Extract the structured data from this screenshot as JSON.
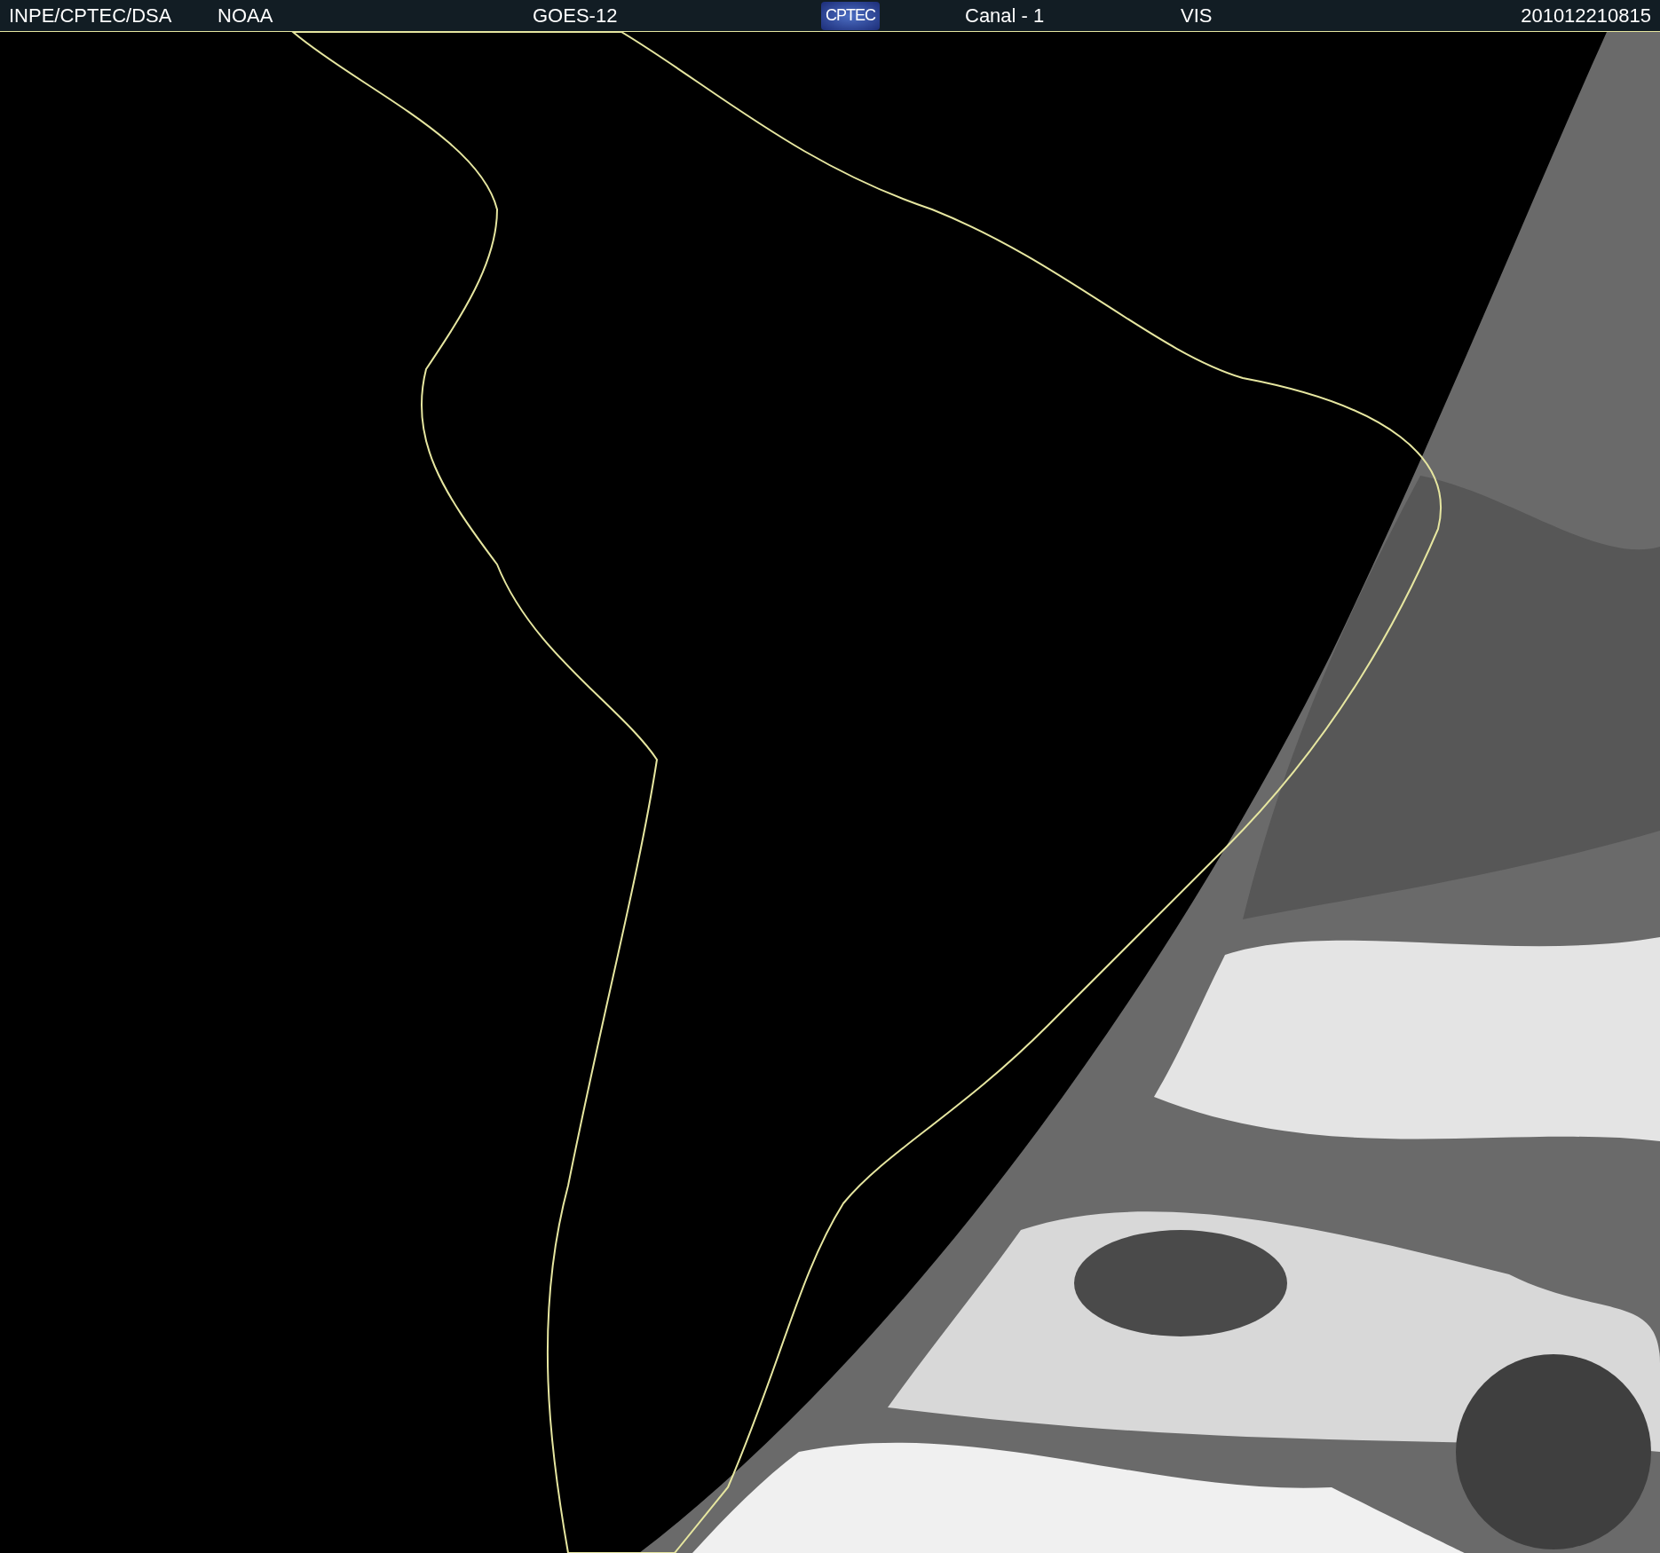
{
  "header": {
    "source": "INPE/CPTEC/DSA",
    "agency": "NOAA",
    "satellite": "GOES-12",
    "logo": "CPTEC",
    "channel": "Canal - 1",
    "band": "VIS",
    "timestamp": "201012210815"
  }
}
